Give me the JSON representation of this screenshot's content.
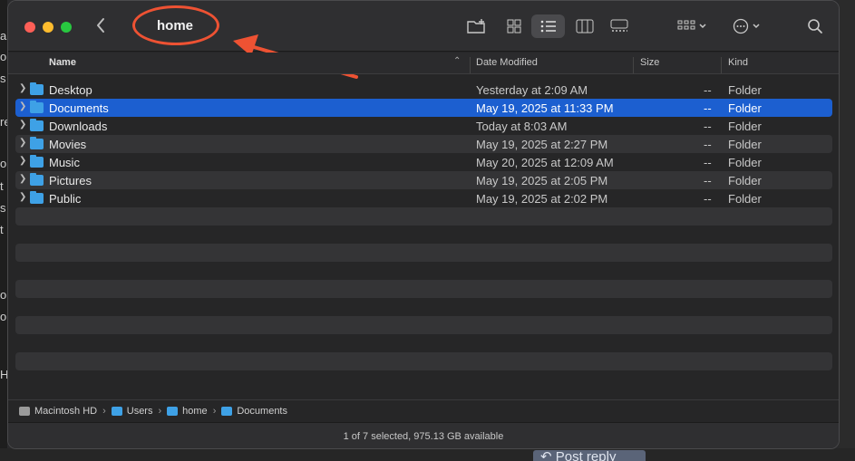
{
  "window": {
    "title": "home"
  },
  "columns": {
    "name": "Name",
    "date": "Date Modified",
    "size": "Size",
    "kind": "Kind"
  },
  "files": [
    {
      "name": "Desktop",
      "date": "Yesterday at 2:09 AM",
      "size": "--",
      "kind": "Folder",
      "selected": false
    },
    {
      "name": "Documents",
      "date": "May 19, 2025 at 11:33 PM",
      "size": "--",
      "kind": "Folder",
      "selected": true
    },
    {
      "name": "Downloads",
      "date": "Today at 8:03 AM",
      "size": "--",
      "kind": "Folder",
      "selected": false
    },
    {
      "name": "Movies",
      "date": "May 19, 2025 at 2:27 PM",
      "size": "--",
      "kind": "Folder",
      "selected": false
    },
    {
      "name": "Music",
      "date": "May 20, 2025 at 12:09 AM",
      "size": "--",
      "kind": "Folder",
      "selected": false
    },
    {
      "name": "Pictures",
      "date": "May 19, 2025 at 2:05 PM",
      "size": "--",
      "kind": "Folder",
      "selected": false
    },
    {
      "name": "Public",
      "date": "May 19, 2025 at 2:02 PM",
      "size": "--",
      "kind": "Folder",
      "selected": false
    }
  ],
  "path_bar": [
    "Macintosh HD",
    "Users",
    "home",
    "Documents"
  ],
  "status": "1 of 7 selected, 975.13 GB available",
  "background": {
    "left_chars": [
      "a",
      "o",
      "s",
      "re",
      "o",
      "t",
      "s",
      "t",
      "o",
      "o",
      "H"
    ],
    "post_reply": "Post reply"
  },
  "colors": {
    "selection": "#1c5fd0",
    "folder": "#3ea1e6",
    "annotation": "#ee5233"
  }
}
